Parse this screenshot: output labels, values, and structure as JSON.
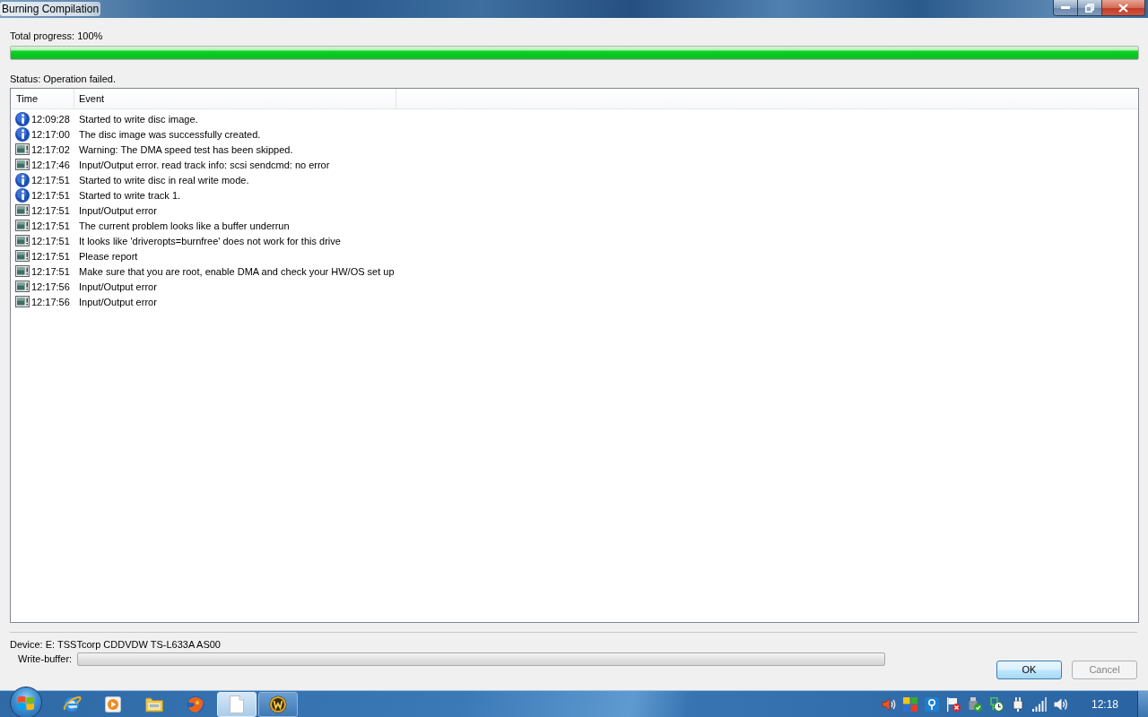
{
  "window": {
    "title": "Burning Compilation"
  },
  "total_progress": {
    "label": "Total progress: 100%",
    "level": 1
  },
  "status": "Status: Operation failed.",
  "log": {
    "columns": [
      "Time",
      "Event"
    ],
    "rows": [
      {
        "kind": "info",
        "time": "12:09:28",
        "event": "Started to write disc image."
      },
      {
        "kind": "info",
        "time": "12:17:00",
        "event": "The disc image was successfully created."
      },
      {
        "kind": "message",
        "time": "12:17:02",
        "event": "Warning: The DMA speed test has been skipped."
      },
      {
        "kind": "message",
        "time": "12:17:46",
        "event": "Input/Output error. read track info: scsi sendcmd: no error"
      },
      {
        "kind": "info",
        "time": "12:17:51",
        "event": "Started to write disc in real write mode."
      },
      {
        "kind": "info",
        "time": "12:17:51",
        "event": "Started to write track 1."
      },
      {
        "kind": "message",
        "time": "12:17:51",
        "event": "Input/Output error"
      },
      {
        "kind": "message",
        "time": "12:17:51",
        "event": "The current problem looks like a buffer underrun"
      },
      {
        "kind": "message",
        "time": "12:17:51",
        "event": "It looks like 'driveropts=burnfree' does not work for this drive"
      },
      {
        "kind": "message",
        "time": "12:17:51",
        "event": "Please report"
      },
      {
        "kind": "message",
        "time": "12:17:51",
        "event": "Make sure that you are root, enable DMA and check your HW/OS set up"
      },
      {
        "kind": "message",
        "time": "12:17:56",
        "event": "Input/Output error"
      },
      {
        "kind": "message",
        "time": "12:17:56",
        "event": "Input/Output error"
      }
    ]
  },
  "device": "Device: E: TSSTcorp CDDVDW TS-L633A AS00",
  "write_buffer": {
    "label": "Write-buffer:",
    "level": 0
  },
  "buttons": [
    {
      "label": "OK",
      "default": true,
      "disabled": false
    },
    {
      "label": "Cancel",
      "default": false,
      "disabled": true
    }
  ],
  "taskbar": {
    "apps": [
      {
        "running": false,
        "selected": false
      },
      {
        "running": false,
        "selected": false
      },
      {
        "running": false,
        "selected": false
      },
      {
        "running": false,
        "selected": false
      },
      {
        "running": true,
        "selected": true
      },
      {
        "running": true,
        "selected": false
      }
    ],
    "clock": "12:18"
  }
}
